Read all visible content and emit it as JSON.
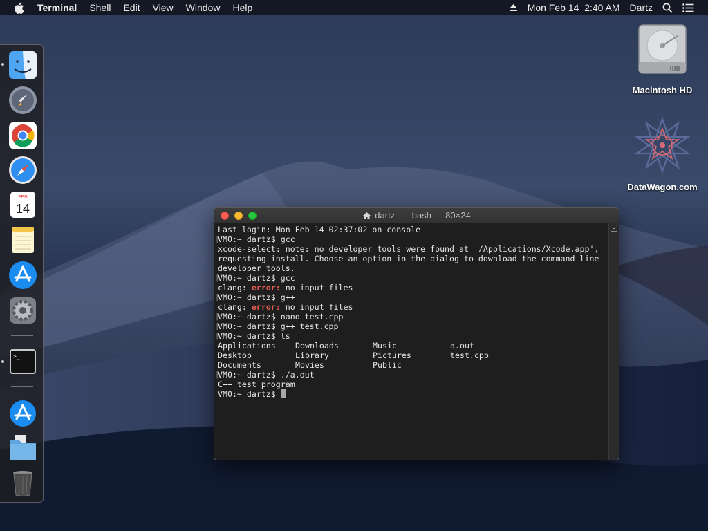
{
  "menubar": {
    "app_name": "Terminal",
    "menus": [
      "Shell",
      "Edit",
      "View",
      "Window",
      "Help"
    ],
    "clock": "Mon Feb 14  2:40 AM",
    "user": "Dartz"
  },
  "desktop": {
    "icons": [
      {
        "label": "Macintosh HD",
        "icon": "hard-drive-icon"
      },
      {
        "label": "DataWagon.com",
        "icon": "datawagon-star-icon"
      }
    ]
  },
  "dock": {
    "apps": [
      "finder-icon",
      "launchpad-icon",
      "chrome-icon",
      "safari-icon",
      "calendar-icon",
      "notes-icon",
      "app-store-icon",
      "system-preferences-icon",
      "terminal-icon",
      "app-store-download-icon",
      "downloads-folder-icon",
      "trash-icon"
    ],
    "calendar": {
      "month": "FEB",
      "day": "14"
    }
  },
  "terminal": {
    "title": "dartz — -bash — 80×24",
    "prompt": "VM0:~ dartz$ ",
    "lines": {
      "l0": "Last login: Mon Feb 14 02:37:02 on console",
      "l1": "gcc",
      "l2": "xcode-select: note: no developer tools were found at '/Applications/Xcode.app',",
      "l3": "requesting install. Choose an option in the dialog to download the command line",
      "l4": "developer tools.",
      "l5": "gcc",
      "clang": "clang: ",
      "err": "error:",
      "no_input": " no input files",
      "l7": "g++",
      "l9": "nano test.cpp",
      "l10": "g++ test.cpp",
      "l11": "ls",
      "l15": "./a.out",
      "l16": "C++ test program"
    },
    "ls": [
      [
        "Applications",
        "Downloads",
        "Music",
        "a.out"
      ],
      [
        "Desktop",
        "Library",
        "Pictures",
        "test.cpp"
      ],
      [
        "Documents",
        "Movies",
        "Public",
        ""
      ]
    ]
  },
  "colors": {
    "error": "#e55c4f",
    "terminal_bg": "#1e1e1e"
  }
}
